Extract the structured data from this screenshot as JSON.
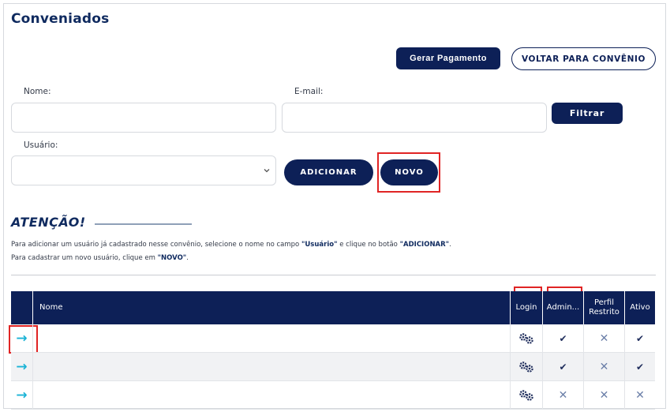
{
  "page": {
    "title": "Conveniados"
  },
  "actions": {
    "gerar_pagamento": "Gerar Pagamento",
    "voltar": "VOLTAR PARA CONVÊNIO"
  },
  "filters": {
    "nome_label": "Nome:",
    "nome_value": "",
    "email_label": "E-mail:",
    "email_value": "",
    "filtrar": "Filtrar",
    "usuario_label": "Usuário:",
    "usuario_selected": "",
    "adicionar": "ADICIONAR",
    "novo": "NOVO"
  },
  "notice": {
    "title": "ATENÇÃO!",
    "line1_prefix": "Para adicionar um usuário já cadastrado nesse convênio, selecione o nome no campo ",
    "line1_b1": "\"Usuário\"",
    "line1_mid": " e clique no botão ",
    "line1_b2": "\"ADICIONAR\"",
    "line1_end": ".",
    "line2_prefix": "Para cadastrar um novo usuário, clique em ",
    "line2_b": "\"NOVO\"",
    "line2_end": "."
  },
  "table": {
    "headers": {
      "nome": "Nome",
      "login": "Login",
      "admin": "Admin...",
      "perfil": "Perfil Restrito",
      "ativo": "Ativo"
    },
    "rows": [
      {
        "nome": "",
        "admin": "check",
        "perfil": "cross",
        "ativo": "check"
      },
      {
        "nome": "",
        "admin": "check",
        "perfil": "cross",
        "ativo": "check"
      },
      {
        "nome": "",
        "admin": "cross",
        "perfil": "cross",
        "ativo": "cross"
      }
    ]
  },
  "icons": {
    "row_action": "arrow-right-icon",
    "login": "gears-icon",
    "check": "check-icon",
    "cross": "cross-icon"
  },
  "colors": {
    "primary": "#0d2057",
    "accent_arrow": "#1bb3d6",
    "highlight": "#e02424"
  }
}
